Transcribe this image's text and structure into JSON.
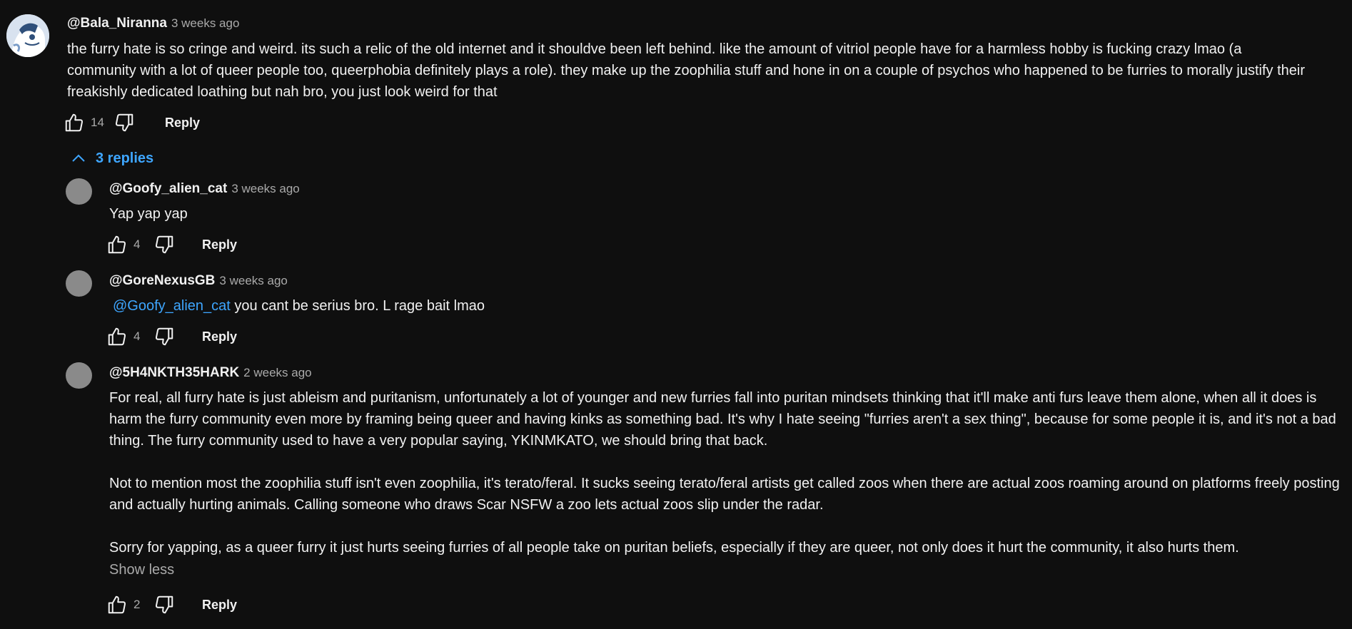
{
  "comment": {
    "author": "@Bala_Niranna",
    "time": "3 weeks ago",
    "text": "the furry hate is so cringe and weird. its such a relic of the old internet and it shouldve been left behind. like the amount of vitriol people have for a harmless hobby is fucking crazy lmao (a community with a lot of queer people too, queerphobia definitely plays a role). they make up the zoophilia stuff and hone in on a couple of psychos who happened to be furries to morally justify their freakishly dedicated loathing but nah bro, you just look weird for that",
    "likes": "14",
    "reply_label": "Reply"
  },
  "replies_toggle": {
    "label": "3 replies"
  },
  "replies": [
    {
      "author": "@Goofy_alien_cat",
      "time": "3 weeks ago",
      "text": "Yap yap yap",
      "likes": "4",
      "reply_label": "Reply"
    },
    {
      "author": "@GoreNexusGB",
      "time": "3 weeks ago",
      "mention": "@Goofy_alien_cat",
      "text": "you cant be serius bro. L rage bait lmao",
      "likes": "4",
      "reply_label": "Reply"
    },
    {
      "author": "@5H4NKTH35HARK",
      "time": "2 weeks ago",
      "paragraphs": [
        "For real, all furry hate is just ableism and puritanism, unfortunately a lot of younger and new furries fall into puritan mindsets thinking that it'll make anti furs leave them alone, when all it does is harm the furry community even more by framing being queer and having kinks as something bad. It's why I hate seeing \"furries aren't a sex thing\", because for some people it is, and it's not a bad thing. The furry community used to have a very popular saying, YKINMKATO, we should bring that back.",
        "Not to mention most the zoophilia stuff isn't even zoophilia, it's terato/feral. It sucks seeing terato/feral artists get called zoos when there are actual zoos roaming around on platforms freely posting and actually hurting animals. Calling someone who draws Scar NSFW a zoo lets actual zoos slip under the radar.",
        "Sorry for yapping, as a queer furry it just hurts seeing furries of all people take on puritan beliefs, especially if they are queer, not only does it hurt the community, it also hurts them."
      ],
      "show_less": "Show less",
      "likes": "2",
      "reply_label": "Reply"
    }
  ],
  "colors": {
    "background": "#0f0f0f",
    "text": "#f1f1f1",
    "secondary_text": "#aaaaaa",
    "link": "#3ea6ff"
  },
  "icons": [
    "thumbs-up-icon",
    "thumbs-down-icon",
    "chevron-up-icon",
    "avatar-image"
  ]
}
